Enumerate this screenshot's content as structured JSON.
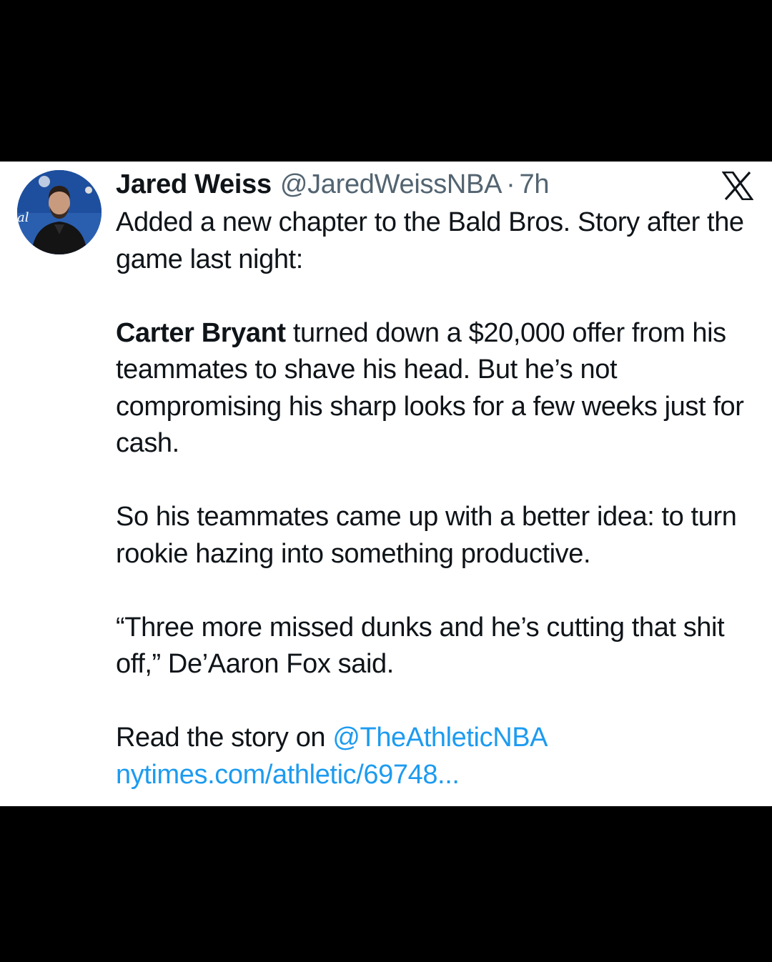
{
  "tweet": {
    "author_name": "Jared Weiss",
    "handle": "@JaredWeissNBA",
    "separator": "·",
    "time": "7h",
    "paragraph1": "Added a new chapter to the Bald Bros. Story after the game last night:",
    "paragraph2_bold": "Carter Bryant",
    "paragraph2_rest": " turned down a $20,000 offer from his teammates to shave his head. But he’s not compromising his sharp looks for a few weeks just for cash.",
    "paragraph3": "So his teammates came up with a better idea: to turn rookie hazing into something productive.",
    "paragraph4": "“Three more missed dunks and he’s cutting that shit off,” De’Aaron Fox said.",
    "read_prefix": "Read the story on ",
    "mention": "@TheAthleticNBA",
    "link": "nytimes.com/athletic/69748..."
  },
  "icons": {
    "avatar": "avatar-photo",
    "brand": "x-logo-icon"
  },
  "colors": {
    "text": "#0f1419",
    "secondary": "#536471",
    "link": "#1d9bf0",
    "background": "#ffffff",
    "frame": "#000000"
  }
}
